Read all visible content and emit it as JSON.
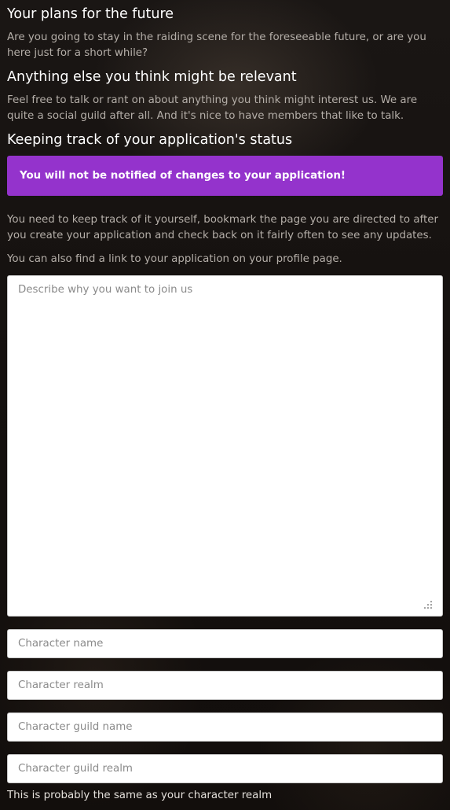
{
  "sections": {
    "plans": {
      "title": "Your plans for the future",
      "text": "Are you going to stay in the raiding scene for the foreseeable future, or are you here just for a short while?"
    },
    "else": {
      "title": "Anything else you think might be relevant",
      "text": "Feel free to talk or rant on about anything you think might interest us. We are quite a social guild after all. And it's nice to have members that like to talk."
    },
    "status": {
      "title": "Keeping track of your application's status",
      "alert": "You will not be notified of changes to your application!",
      "text1": "You need to keep track of it yourself, bookmark the page you are directed to after you create your application and check back on it fairly often to see any updates.",
      "text2": "You can also find a link to your application on your profile page."
    }
  },
  "form": {
    "motivation_placeholder": "Describe why you want to join us",
    "character_name_placeholder": "Character name",
    "character_realm_placeholder": "Character realm",
    "guild_name_placeholder": "Character guild name",
    "guild_realm_placeholder": "Character guild realm",
    "guild_realm_help": "This is probably the same as your character realm"
  },
  "colors": {
    "alert_background": "#9433cc",
    "body_text": "#b4aea8",
    "heading_text": "#ffffff"
  },
  "icons": {
    "textarea_resize": "resize-grip-icon"
  }
}
